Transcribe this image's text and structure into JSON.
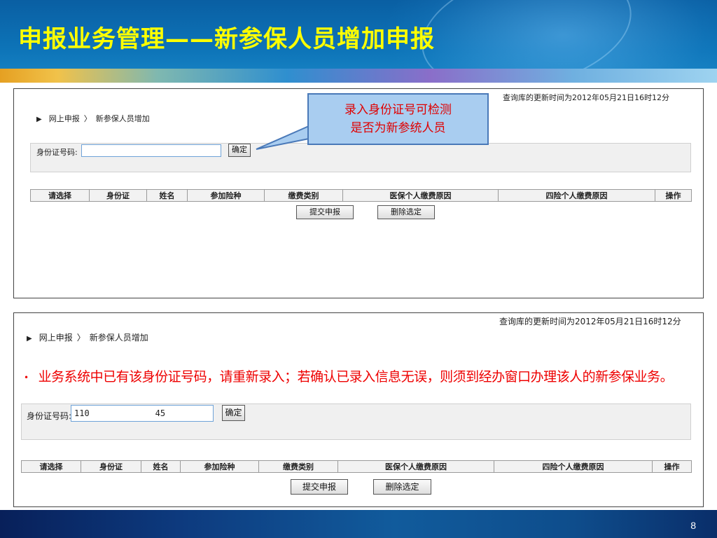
{
  "slide": {
    "title": "申报业务管理——新参保人员增加申报",
    "page_number": "8",
    "colors": {
      "title": "#ffff00",
      "header_blue": "#0d74b8",
      "warning_red": "#ee0000",
      "callout_fill": "#a9cdf0"
    }
  },
  "callout": {
    "line1": "录入身份证号可检测",
    "line2": "是否为新参统人员"
  },
  "warning": {
    "bullet": "•",
    "text": "业务系统中已有该身份证号码，请重新录入；若确认已录入信息无误，则须到经办窗口办理该人的新参保业务。"
  },
  "panel1": {
    "update_time": "查询库的更新时间为2012年05月21日16时12分",
    "breadcrumb": {
      "arrow_icon": "triangle-right-icon",
      "root": "网上申报",
      "sep": "〉",
      "current": "新参保人员增加"
    },
    "id_label": "身份证号码:",
    "id_value": "",
    "confirm_label": "确定",
    "columns": [
      "请选择",
      "身份证",
      "姓名",
      "参加险种",
      "缴费类别",
      "医保个人缴费原因",
      "四险个人缴费原因",
      "操作"
    ],
    "submit_label": "提交申报",
    "delete_label": "删除选定"
  },
  "panel2": {
    "update_time": "查询库的更新时间为2012年05月21日16时12分",
    "breadcrumb": {
      "arrow_icon": "triangle-right-icon",
      "root": "网上申报",
      "sep": "〉",
      "current": "新参保人员增加"
    },
    "id_label": "身份证号码:",
    "id_value": "110             45",
    "confirm_label": "确定",
    "columns": [
      "请选择",
      "身份证",
      "姓名",
      "参加险种",
      "缴费类别",
      "医保个人缴费原因",
      "四险个人缴费原因",
      "操作"
    ],
    "submit_label": "提交申报",
    "delete_label": "删除选定"
  }
}
